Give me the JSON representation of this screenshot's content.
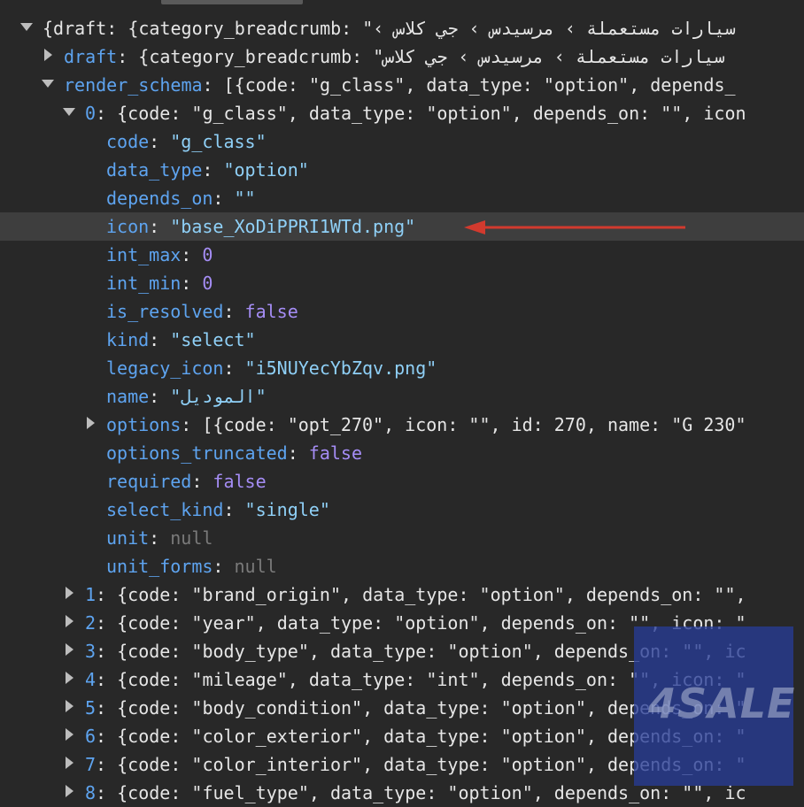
{
  "root": {
    "summary": "{draft: {category_breadcrumb: \"",
    "summary_rtl": "سيارات مستعملة › مرسيدس › جي كلاس ›"
  },
  "draft": {
    "key": "draft",
    "summary": ": {category_breadcrumb: \"",
    "summary_rtl": "سيارات مستعملة › مرسيدس › جي كلاس"
  },
  "render_schema": {
    "key": "render_schema",
    "summary": ": [{code: \"g_class\", data_type: \"option\", depends_"
  },
  "item0": {
    "key": "0",
    "summary": ": {code: \"g_class\", data_type: \"option\", depends_on: \"\", icon",
    "props": [
      {
        "key": "code",
        "value": "\"g_class\"",
        "type": "s"
      },
      {
        "key": "data_type",
        "value": "\"option\"",
        "type": "s"
      },
      {
        "key": "depends_on",
        "value": "\"\"",
        "type": "s"
      },
      {
        "key": "icon",
        "value": "\"base_XoDiPPRI1WTd.png\"",
        "type": "s"
      },
      {
        "key": "int_max",
        "value": "0",
        "type": "n"
      },
      {
        "key": "int_min",
        "value": "0",
        "type": "n"
      },
      {
        "key": "is_resolved",
        "value": "false",
        "type": "n"
      },
      {
        "key": "kind",
        "value": "\"select\"",
        "type": "s"
      },
      {
        "key": "legacy_icon",
        "value": "\"i5NUYecYbZqv.png\"",
        "type": "s"
      },
      {
        "key": "name",
        "value": "\"الموديل\"",
        "type": "s"
      },
      {
        "key": "options",
        "value": "[{code: \"opt_270\", icon: \"\", id: 270, name: \"G 230\"",
        "type": "collapsed"
      },
      {
        "key": "options_truncated",
        "value": "false",
        "type": "n"
      },
      {
        "key": "required",
        "value": "false",
        "type": "n"
      },
      {
        "key": "select_kind",
        "value": "\"single\"",
        "type": "s"
      },
      {
        "key": "unit",
        "value": "null",
        "type": "nl"
      },
      {
        "key": "unit_forms",
        "value": "null",
        "type": "nl"
      }
    ]
  },
  "items": [
    {
      "key": "1",
      "summary": ": {code: \"brand_origin\", data_type: \"option\", depends_on: \"\", "
    },
    {
      "key": "2",
      "summary": ": {code: \"year\", data_type: \"option\", depends_on: \"\", icon: \""
    },
    {
      "key": "3",
      "summary": ": {code: \"body_type\", data_type: \"option\", depends_on: \"\", ic"
    },
    {
      "key": "4",
      "summary": ": {code: \"mileage\", data_type: \"int\", depends_on: \"\", icon: \""
    },
    {
      "key": "5",
      "summary": ": {code: \"body_condition\", data_type: \"option\", depends_on: \""
    },
    {
      "key": "6",
      "summary": ": {code: \"color_exterior\", data_type: \"option\", depends_on: \""
    },
    {
      "key": "7",
      "summary": ": {code: \"color_interior\", data_type: \"option\", depends_on: \""
    },
    {
      "key": "8",
      "summary": ": {code: \"fuel_type\", data_type: \"option\", depends_on: \"\", ic"
    }
  ],
  "watermark": "4SALE",
  "colors": {
    "background": "#282828",
    "key": "#5ea4f0",
    "string": "#8fd0f7",
    "number": "#a58df5",
    "null": "#7a7a7a",
    "highlight_row": "#3e3e3e",
    "annotation_arrow": "#d23a2e",
    "watermark": "#283c96"
  }
}
